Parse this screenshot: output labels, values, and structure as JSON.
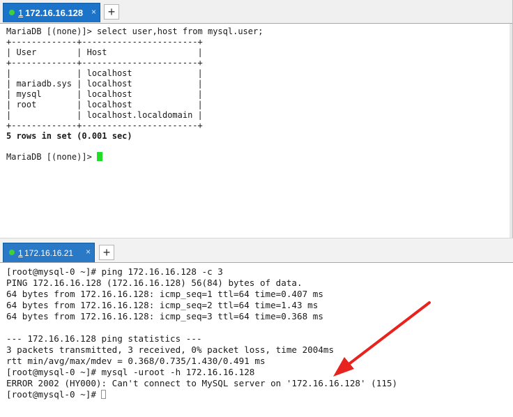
{
  "top_pane": {
    "tab": {
      "number": "1",
      "host": "172.16.16.128",
      "close_glyph": "×"
    },
    "add_tab_glyph": "+",
    "lines": [
      "MariaDB [(none)]> select user,host from mysql.user;",
      "+-------------+-----------------------+",
      "| User        | Host                  |",
      "+-------------+-----------------------+",
      "|             | localhost             |",
      "| mariadb.sys | localhost             |",
      "| mysql       | localhost             |",
      "| root        | localhost             |",
      "|             | localhost.localdomain |",
      "+-------------+-----------------------+"
    ],
    "result_line": "5 rows in set (0.001 sec)",
    "prompt": "MariaDB [(none)]> "
  },
  "bottom_pane": {
    "tab": {
      "number": "1",
      "host": "172.16.16.21",
      "close_glyph": "×"
    },
    "add_tab_glyph": "+",
    "lines": [
      "[root@mysql-0 ~]# ping 172.16.16.128 -c 3",
      "PING 172.16.16.128 (172.16.16.128) 56(84) bytes of data.",
      "64 bytes from 172.16.16.128: icmp_seq=1 ttl=64 time=0.407 ms",
      "64 bytes from 172.16.16.128: icmp_seq=2 ttl=64 time=1.43 ms",
      "64 bytes from 172.16.16.128: icmp_seq=3 ttl=64 time=0.368 ms",
      "",
      "--- 172.16.16.128 ping statistics ---",
      "3 packets transmitted, 3 received, 0% packet loss, time 2004ms",
      "rtt min/avg/max/mdev = 0.368/0.735/1.430/0.491 ms",
      "[root@mysql-0 ~]# mysql -uroot -h 172.16.16.128",
      "ERROR 2002 (HY000): Can't connect to MySQL server on '172.16.16.128' (115)"
    ],
    "prompt": "[root@mysql-0 ~]# "
  },
  "colors": {
    "tab_active": "#1b74c9",
    "connected_dot": "#3fd13a",
    "cursor": "#22dd22",
    "annotation_arrow": "#e8231f"
  }
}
